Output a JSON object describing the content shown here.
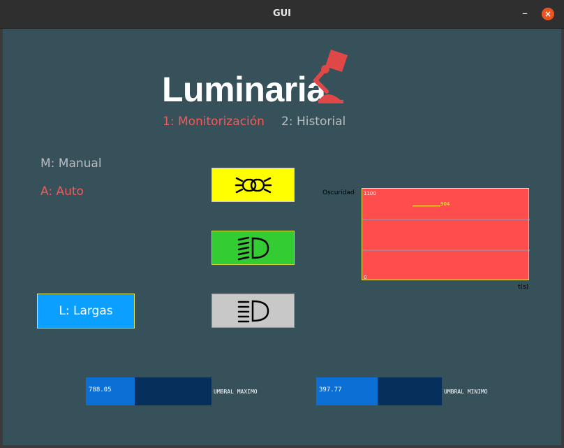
{
  "window": {
    "title": "GUI",
    "minimize_glyph": "–",
    "close_glyph": "×"
  },
  "logo": {
    "text": "Luminaria",
    "icon": "desk-lamp-icon",
    "icon_color": "#e04848"
  },
  "tabs": [
    {
      "label": "1: Monitorización",
      "active": true
    },
    {
      "label": "2: Historial",
      "active": false
    }
  ],
  "modes": {
    "manual": "M: Manual",
    "auto": "A: Auto",
    "active": "auto"
  },
  "lights": [
    {
      "name": "posicion",
      "icon": "position-lights-icon",
      "color": "#ffff00"
    },
    {
      "name": "cortas",
      "icon": "low-beam-icon",
      "color": "#33cc33"
    },
    {
      "name": "largas",
      "icon": "high-beam-icon",
      "color": "#c8c8c8"
    }
  ],
  "largas_button": {
    "label": "L: Largas"
  },
  "chart_data": {
    "type": "line",
    "ylabel": "Oscuridad",
    "xlabel": "t(s)",
    "ylim": [
      0,
      1100
    ],
    "ytick_labels": [
      "1100",
      "0"
    ],
    "series": [
      {
        "values": [
          904,
          904,
          904,
          904,
          904,
          904
        ]
      }
    ],
    "annotation": "904",
    "grid": true,
    "background_color": "#ff4d4d"
  },
  "thresholds": [
    {
      "value": "788.05",
      "label": "UMBRAL MAXIMO",
      "fraction": 0.39
    },
    {
      "value": "397.77",
      "label": "UMBRAL MINIMO",
      "fraction": 0.49
    }
  ]
}
